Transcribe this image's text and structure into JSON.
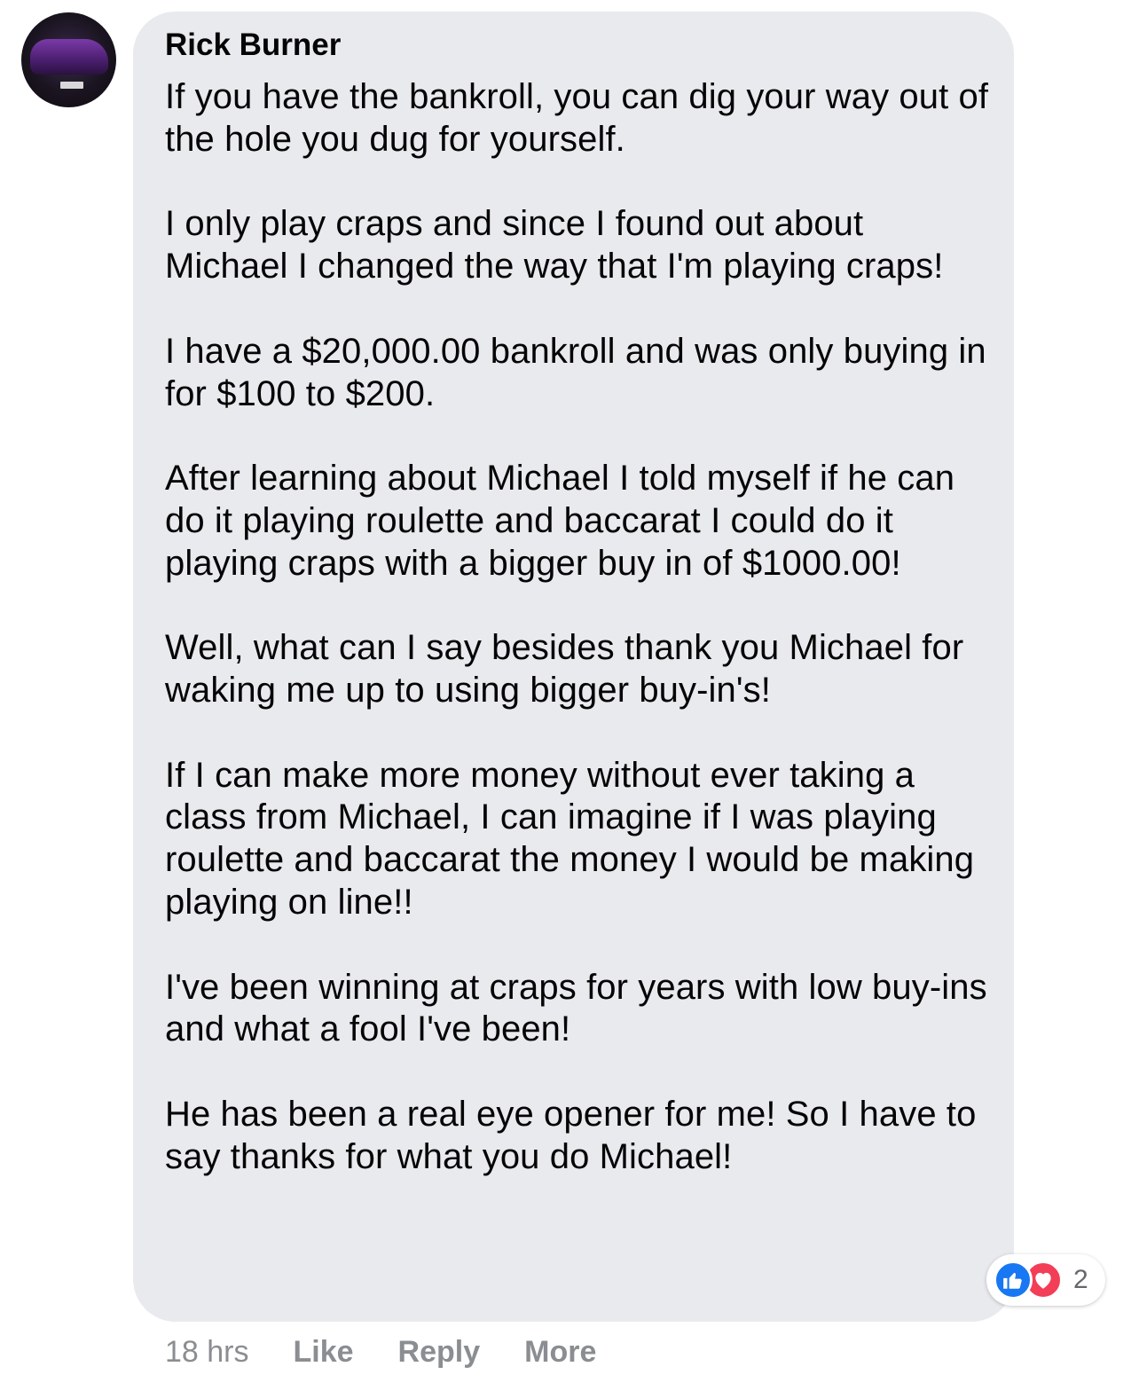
{
  "comment": {
    "author": "Rick Burner",
    "paragraphs": [
      "If you have the bankroll, you can dig your way out of the hole you dug for yourself.",
      "I only play craps and since I found out about Michael I changed the way that I'm playing craps!",
      "I have a $20,000.00 bankroll and was only buying in for $100 to $200.",
      "After learning about Michael I told myself if he can do it playing roulette and baccarat I could do it playing craps with a bigger buy in of $1000.00!",
      "Well, what can I say besides thank you Michael for waking me up to using bigger buy-in's!",
      "If I can make more money without ever taking a class from Michael, I can imagine if I was playing roulette and baccarat the money I would be making playing on line!!",
      "I've been winning at craps for years with low buy-ins and what a fool I've been!",
      "He has been a real eye opener for me! So I have to say thanks for what you do Michael!"
    ],
    "reactions": {
      "icons": [
        "like-icon",
        "love-icon"
      ],
      "count": "2",
      "like_color": "#1877f2",
      "love_color": "#f33e58"
    },
    "actions": {
      "timestamp": "18 hrs",
      "like_label": "Like",
      "reply_label": "Reply",
      "more_label": "More"
    },
    "bubble_color": "#e9eaee"
  }
}
